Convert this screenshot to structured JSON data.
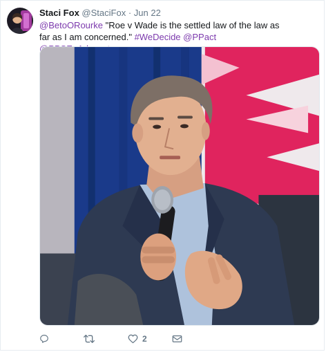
{
  "tweet": {
    "author_name": "Staci Fox",
    "author_handle": "@StaciFox",
    "separator": "·",
    "date": "Jun 22",
    "mention_beto": "@BetoORourke",
    "quote": " \"Roe v Wade is the settled law of the law as far as I am concerned.\" ",
    "hashtag": "#WeDecide",
    "mention_ppact": "@PPact",
    "mention_ppse": "@PPSE_Advocates"
  },
  "actions": {
    "reply_icon": "reply-icon",
    "retweet_icon": "retweet-icon",
    "like_icon": "heart-icon",
    "like_count": "2",
    "dm_icon": "envelope-icon"
  },
  "colors": {
    "link": "#1b95e0",
    "mention": "#7c3aad",
    "muted": "#657786",
    "stage_pink": "#e0245e",
    "curtain_blue": "#1a3a8a"
  }
}
